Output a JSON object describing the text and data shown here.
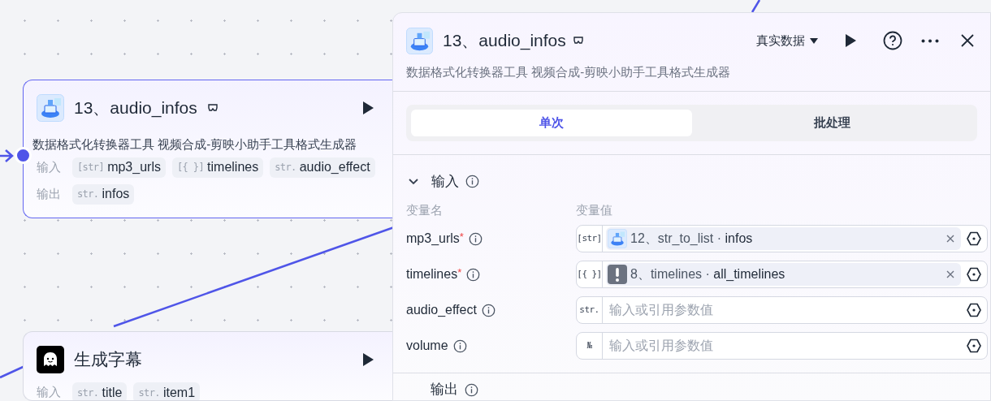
{
  "canvas": {
    "nodes": [
      {
        "kind": "tool",
        "title": "13、audio_infos",
        "description": "数据格式化转换器工具 视频合成-剪映小助手工具格式生成器",
        "port": true,
        "rows": [
          {
            "label": "输入",
            "chips": [
              {
                "type": "[str]",
                "name": "mp3_urls"
              },
              {
                "type": "[{ }]",
                "name": "timelines"
              },
              {
                "type": "str.",
                "name": "audio_effect"
              }
            ]
          },
          {
            "label": "输出",
            "chips": [
              {
                "type": "str.",
                "name": "infos"
              }
            ]
          }
        ]
      },
      {
        "kind": "ghost",
        "title": "生成字幕",
        "port": false,
        "rows": [
          {
            "label": "输入",
            "chips": [
              {
                "type": "str.",
                "name": "title"
              },
              {
                "type": "str.",
                "name": "item1"
              }
            ]
          }
        ]
      }
    ]
  },
  "panel": {
    "title": "13、audio_infos",
    "data_mode": "真实数据",
    "description": "数据格式化转换器工具 视频合成-剪映小助手工具格式生成器",
    "tabs": [
      {
        "label": "单次",
        "selected": true
      },
      {
        "label": "批处理",
        "selected": false
      }
    ],
    "input_section": {
      "title": "输入",
      "expanded": true,
      "columns": [
        "变量名",
        "变量值"
      ],
      "fields": [
        {
          "name": "mp3_urls",
          "required_mark": "*",
          "type": "[str]",
          "ref": {
            "kind": "tool",
            "node": "12、str_to_list",
            "separator": "·",
            "output": "infos"
          }
        },
        {
          "name": "timelines",
          "required_mark": "*",
          "type": "[{ }]",
          "ref": {
            "kind": "warning",
            "node": "8、timelines",
            "separator": "·",
            "output": "all_timelines"
          }
        },
        {
          "name": "audio_effect",
          "type": "str.",
          "placeholder": "输入或引用参数值"
        },
        {
          "name": "volume",
          "type": "№",
          "placeholder": "输入或引用参数值"
        }
      ]
    },
    "output_section": {
      "title": "输出"
    }
  }
}
